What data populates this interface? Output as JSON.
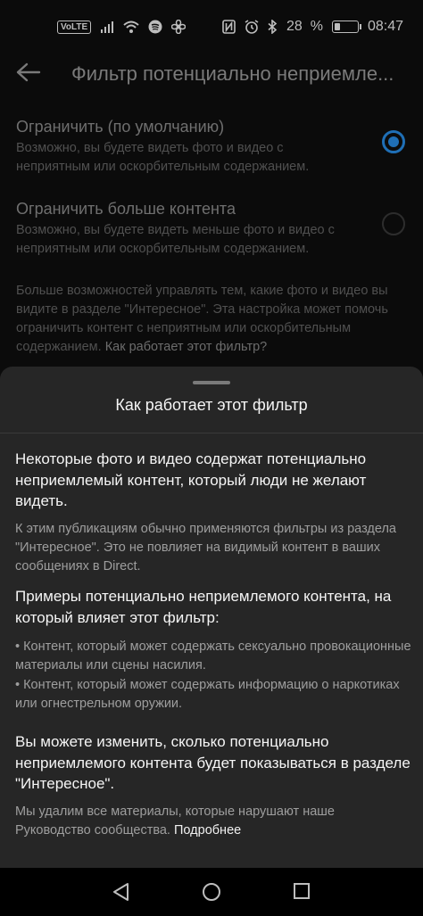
{
  "status": {
    "volte": "VoLTE",
    "percent_value": "28",
    "percent_sign": "%",
    "time": "08:47",
    "battery_level": 0.28,
    "icons": [
      "volte-icon",
      "signal-icon",
      "wifi-icon",
      "spotify-icon",
      "fan-icon",
      "nfc-icon",
      "alarm-icon",
      "bluetooth-icon",
      "battery-icon"
    ]
  },
  "page": {
    "title": "Фильтр потенциально неприемле...",
    "options": [
      {
        "title": "Ограничить (по умолчанию)",
        "desc": "Возможно, вы будете видеть фото и видео с неприятным или оскорбительным содержанием.",
        "selected": true
      },
      {
        "title": "Ограничить больше контента",
        "desc": "Возможно, вы будете видеть меньше фото и видео с неприятным или оскорбительным содержанием.",
        "selected": false
      }
    ],
    "info_text": "Больше возможностей управлять тем, какие фото и видео вы видите в разделе \"Интересное\". Эта настройка может помочь ограничить контент с неприятным или оскорбительным содержанием. ",
    "info_link": "Как работает этот фильтр?"
  },
  "sheet": {
    "title": "Как работает этот фильтр",
    "s1_heading": "Некоторые фото и видео содержат потенциально неприемлемый контент, который люди не желают видеть.",
    "s1_text": "К этим публикациям обычно применяются фильтры из раздела \"Интересное\". Это не повлияет на видимый контент в ваших сообщениях в Direct.",
    "s2_heading": "Примеры потенциально неприемлемого контента, на который влияет этот фильтр:",
    "s2_bullet1": "• Контент, который может содержать сексуально провокационные материалы или сцены насилия.",
    "s2_bullet2": "•  Контент, который может содержать информацию о наркотиках или огнестрельном оружии.",
    "s3_heading": "Вы можете изменить, сколько потенциально неприемлемого контента будет показываться в разделе \"Интересное\".",
    "s3_text": "Мы удалим все материалы, которые нарушают наше Руководство сообщества. ",
    "s3_link": "Подробнее"
  },
  "accent": "#1f6fb6"
}
